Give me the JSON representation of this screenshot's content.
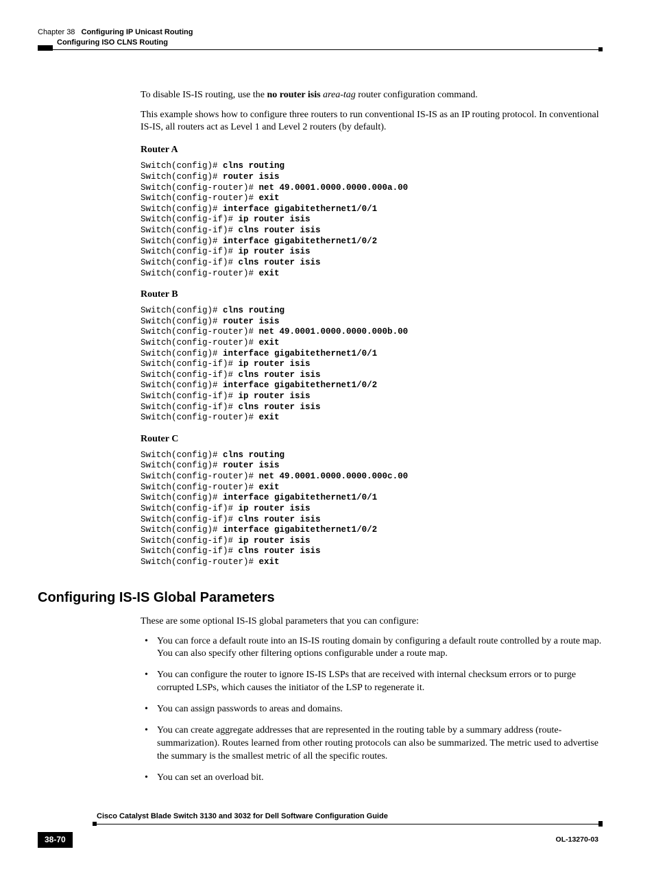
{
  "header": {
    "section_left": "Configuring ISO CLNS Routing",
    "chapter_label": "Chapter 38",
    "chapter_title": "Configuring IP Unicast Routing"
  },
  "intro": {
    "p1_pre": "To disable IS-IS routing, use the ",
    "p1_bold": "no router isis",
    "p1_italic": " area-tag",
    "p1_post": " router configuration command.",
    "p2": "This example shows how to configure three routers to run conventional IS-IS as an IP routing protocol. In conventional IS-IS, all routers act as Level 1 and Level 2 routers (by default)."
  },
  "routers": {
    "a": {
      "title": "Router A",
      "lines": [
        {
          "prompt": "Switch(config)# ",
          "cmd": "clns routing"
        },
        {
          "prompt": "Switch(config)# ",
          "cmd": "router isis"
        },
        {
          "prompt": "Switch(config-router)# ",
          "cmd": "net 49.0001.0000.0000.000a.00"
        },
        {
          "prompt": "Switch(config-router)# ",
          "cmd": "exit"
        },
        {
          "prompt": "Switch(config)# ",
          "cmd": "interface gigabitethernet1/0/1"
        },
        {
          "prompt": "Switch(config-if)# ",
          "cmd": "ip router isis"
        },
        {
          "prompt": "Switch(config-if)# ",
          "cmd": "clns router isis"
        },
        {
          "prompt": "Switch(config)# ",
          "cmd": "interface gigabitethernet1/0/2"
        },
        {
          "prompt": "Switch(config-if)# ",
          "cmd": "ip router isis"
        },
        {
          "prompt": "Switch(config-if)# ",
          "cmd": "clns router isis"
        },
        {
          "prompt": "Switch(config-router)# ",
          "cmd": "exit"
        }
      ]
    },
    "b": {
      "title": "Router B",
      "lines": [
        {
          "prompt": "Switch(config)# ",
          "cmd": "clns routing"
        },
        {
          "prompt": "Switch(config)# ",
          "cmd": "router isis"
        },
        {
          "prompt": "Switch(config-router)# ",
          "cmd": "net 49.0001.0000.0000.000b.00"
        },
        {
          "prompt": "Switch(config-router)# ",
          "cmd": "exit"
        },
        {
          "prompt": "Switch(config)# ",
          "cmd": "interface gigabitethernet1/0/1"
        },
        {
          "prompt": "Switch(config-if)# ",
          "cmd": "ip router isis"
        },
        {
          "prompt": "Switch(config-if)# ",
          "cmd": "clns router isis"
        },
        {
          "prompt": "Switch(config)# ",
          "cmd": "interface gigabitethernet1/0/2"
        },
        {
          "prompt": "Switch(config-if)# ",
          "cmd": "ip router isis"
        },
        {
          "prompt": "Switch(config-if)# ",
          "cmd": "clns router isis"
        },
        {
          "prompt": "Switch(config-router)# ",
          "cmd": "exit"
        }
      ]
    },
    "c": {
      "title": "Router C",
      "lines": [
        {
          "prompt": "Switch(config)# ",
          "cmd": "clns routing"
        },
        {
          "prompt": "Switch(config)# ",
          "cmd": "router isis"
        },
        {
          "prompt": "Switch(config-router)# ",
          "cmd": "net 49.0001.0000.0000.000c.00"
        },
        {
          "prompt": "Switch(config-router)# ",
          "cmd": "exit"
        },
        {
          "prompt": "Switch(config)# ",
          "cmd": "interface gigabitethernet1/0/1"
        },
        {
          "prompt": "Switch(config-if)# ",
          "cmd": "ip router isis"
        },
        {
          "prompt": "Switch(config-if)# ",
          "cmd": "clns router isis"
        },
        {
          "prompt": "Switch(config)# ",
          "cmd": "interface gigabitethernet1/0/2"
        },
        {
          "prompt": "Switch(config-if)# ",
          "cmd": "ip router isis"
        },
        {
          "prompt": "Switch(config-if)# ",
          "cmd": "clns router isis"
        },
        {
          "prompt": "Switch(config-router)# ",
          "cmd": "exit"
        }
      ]
    }
  },
  "section": {
    "heading": "Configuring IS-IS Global Parameters",
    "intro": "These are some optional IS-IS global parameters that you can configure:",
    "bullets": [
      "You can force a default route into an IS-IS routing domain by configuring a default route controlled by a route map. You can also specify other filtering options configurable under a route map.",
      "You can configure the router to ignore IS-IS LSPs that are received with internal checksum errors or to purge corrupted LSPs, which causes the initiator of the LSP to regenerate it.",
      "You can assign passwords to areas and domains.",
      "You can create aggregate addresses that are represented in the routing table by a summary address (route-summarization). Routes learned from other routing protocols can also be summarized. The metric used to advertise the summary is the smallest metric of all the specific routes.",
      "You can set an overload bit."
    ]
  },
  "footer": {
    "book_title": "Cisco Catalyst Blade Switch 3130 and 3032 for Dell Software Configuration Guide",
    "page": "38-70",
    "doc_id": "OL-13270-03"
  }
}
